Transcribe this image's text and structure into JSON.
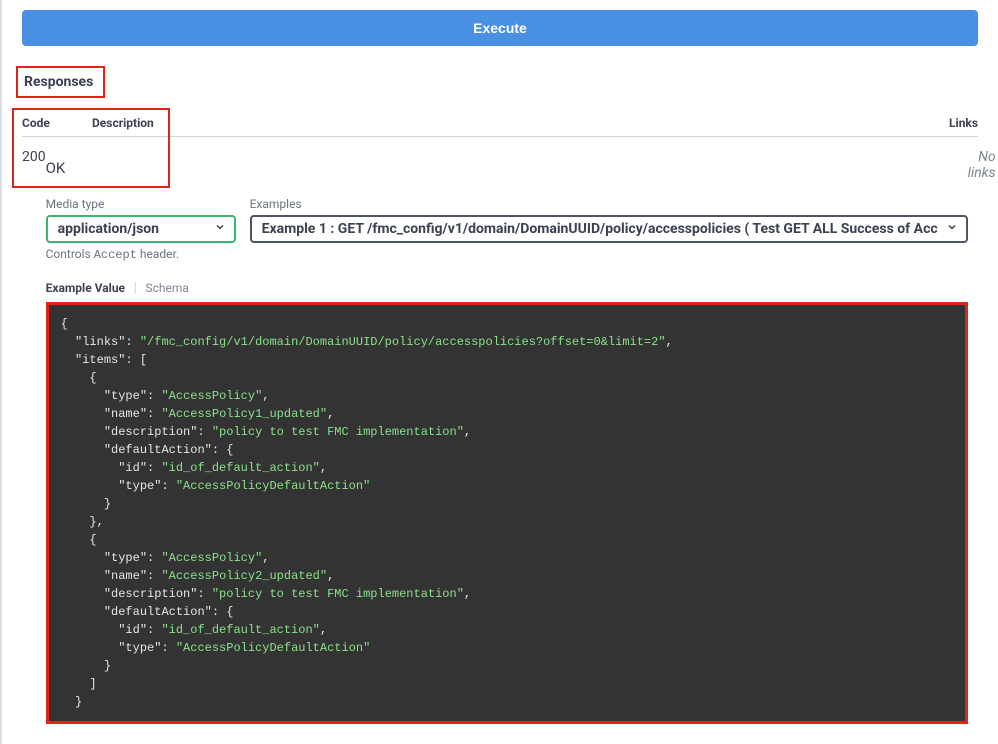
{
  "execute_label": "Execute",
  "responses_header": "Responses",
  "table": {
    "code_header": "Code",
    "desc_header": "Description",
    "links_header": "Links",
    "code_value": "200",
    "ok_text": "OK",
    "links_value": "No links"
  },
  "media": {
    "label": "Media type",
    "value": "application/json",
    "hint_prefix": "Controls ",
    "hint_code": "Accept",
    "hint_suffix": " header."
  },
  "examples": {
    "label": "Examples",
    "value": "Example 1 : GET /fmc_config/v1/domain/DomainUUID/policy/accesspolicies ( Test GET ALL Success of Acc"
  },
  "tabs": {
    "example_value": "Example Value",
    "schema": "Schema"
  },
  "code_sample": {
    "links_key": "\"links\"",
    "links_val": "\"/fmc_config/v1/domain/DomainUUID/policy/accesspolicies?offset=0&limit=2\"",
    "items_key": "\"items\"",
    "type_key": "\"type\"",
    "type_val_ap": "\"AccessPolicy\"",
    "name_key": "\"name\"",
    "name_val1": "\"AccessPolicy1_updated\"",
    "name_val2": "\"AccessPolicy2_updated\"",
    "desc_key": "\"description\"",
    "desc_val": "\"policy to test FMC implementation\"",
    "da_key": "\"defaultAction\"",
    "id_key": "\"id\"",
    "id_val": "\"id_of_default_action\"",
    "da_type_val": "\"AccessPolicyDefaultAction\""
  }
}
